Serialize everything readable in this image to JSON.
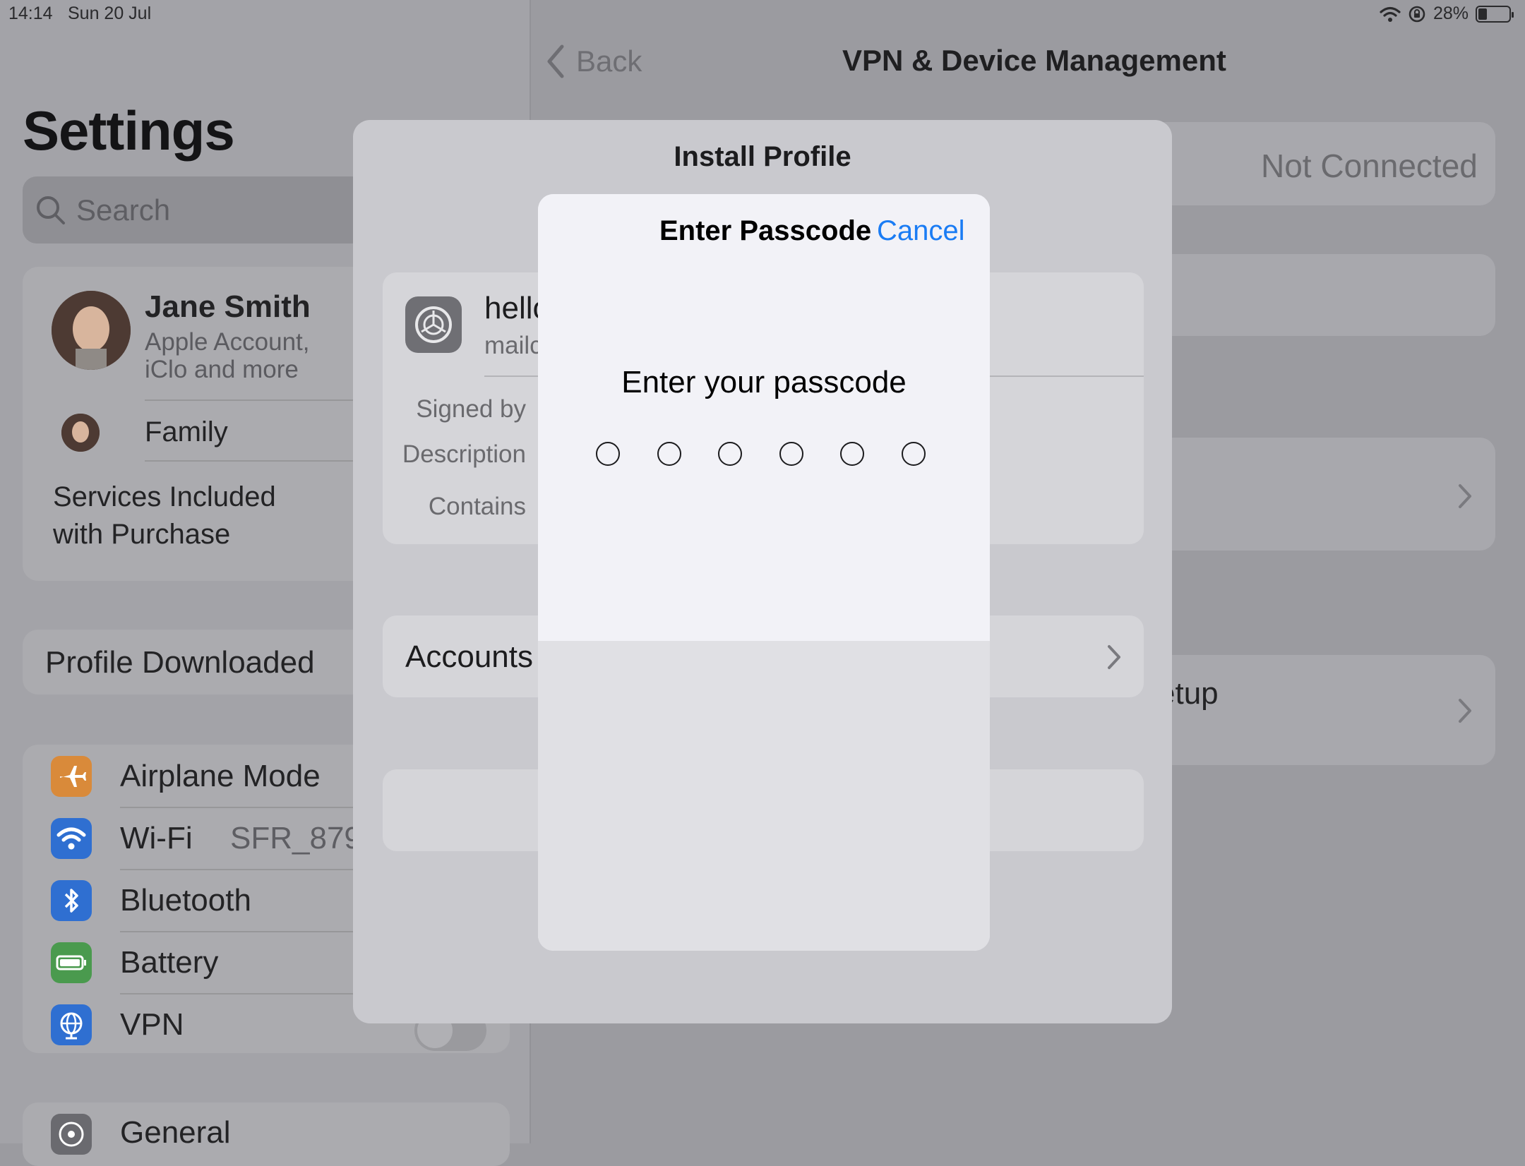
{
  "status_bar": {
    "time": "14:14",
    "date": "Sun 20 Jul",
    "battery": "28%",
    "icons": [
      "wifi-icon",
      "orientation-lock-icon",
      "battery-icon"
    ]
  },
  "sidebar": {
    "title": "Settings",
    "search_placeholder": "Search",
    "account": {
      "name": "Jane Smith",
      "subtitle": "Apple Account, iClo and more",
      "family": "Family",
      "services": "Services Included with Purchase"
    },
    "profile_downloaded": "Profile Downloaded",
    "items": [
      {
        "label": "Airplane Mode",
        "icon": "airplane-icon",
        "color": "#d98a3a"
      },
      {
        "label": "Wi-Fi",
        "value": "SFR_879",
        "icon": "wifi-icon",
        "color": "#2f6fd1"
      },
      {
        "label": "Bluetooth",
        "icon": "bluetooth-icon",
        "color": "#2f6fd1"
      },
      {
        "label": "Battery",
        "icon": "battery-icon",
        "color": "#4a9a4e"
      },
      {
        "label": "VPN",
        "icon": "globe-icon",
        "color": "#2f6fd1"
      }
    ],
    "general": "General"
  },
  "detail": {
    "back": "Back",
    "title": "VPN & Device Management",
    "vpn_status": "Not Connected",
    "setup_fragment": "etup"
  },
  "install_profile": {
    "title": "Install Profile",
    "profile_name": "hello",
    "profile_sub": "mailc",
    "labels": {
      "signed_by": "Signed by",
      "description": "Description",
      "contains": "Contains"
    },
    "accounts": "Accounts"
  },
  "passcode_modal": {
    "title": "Enter Passcode",
    "cancel": "Cancel",
    "prompt": "Enter your passcode",
    "digit_count": 6,
    "entered": 0
  }
}
